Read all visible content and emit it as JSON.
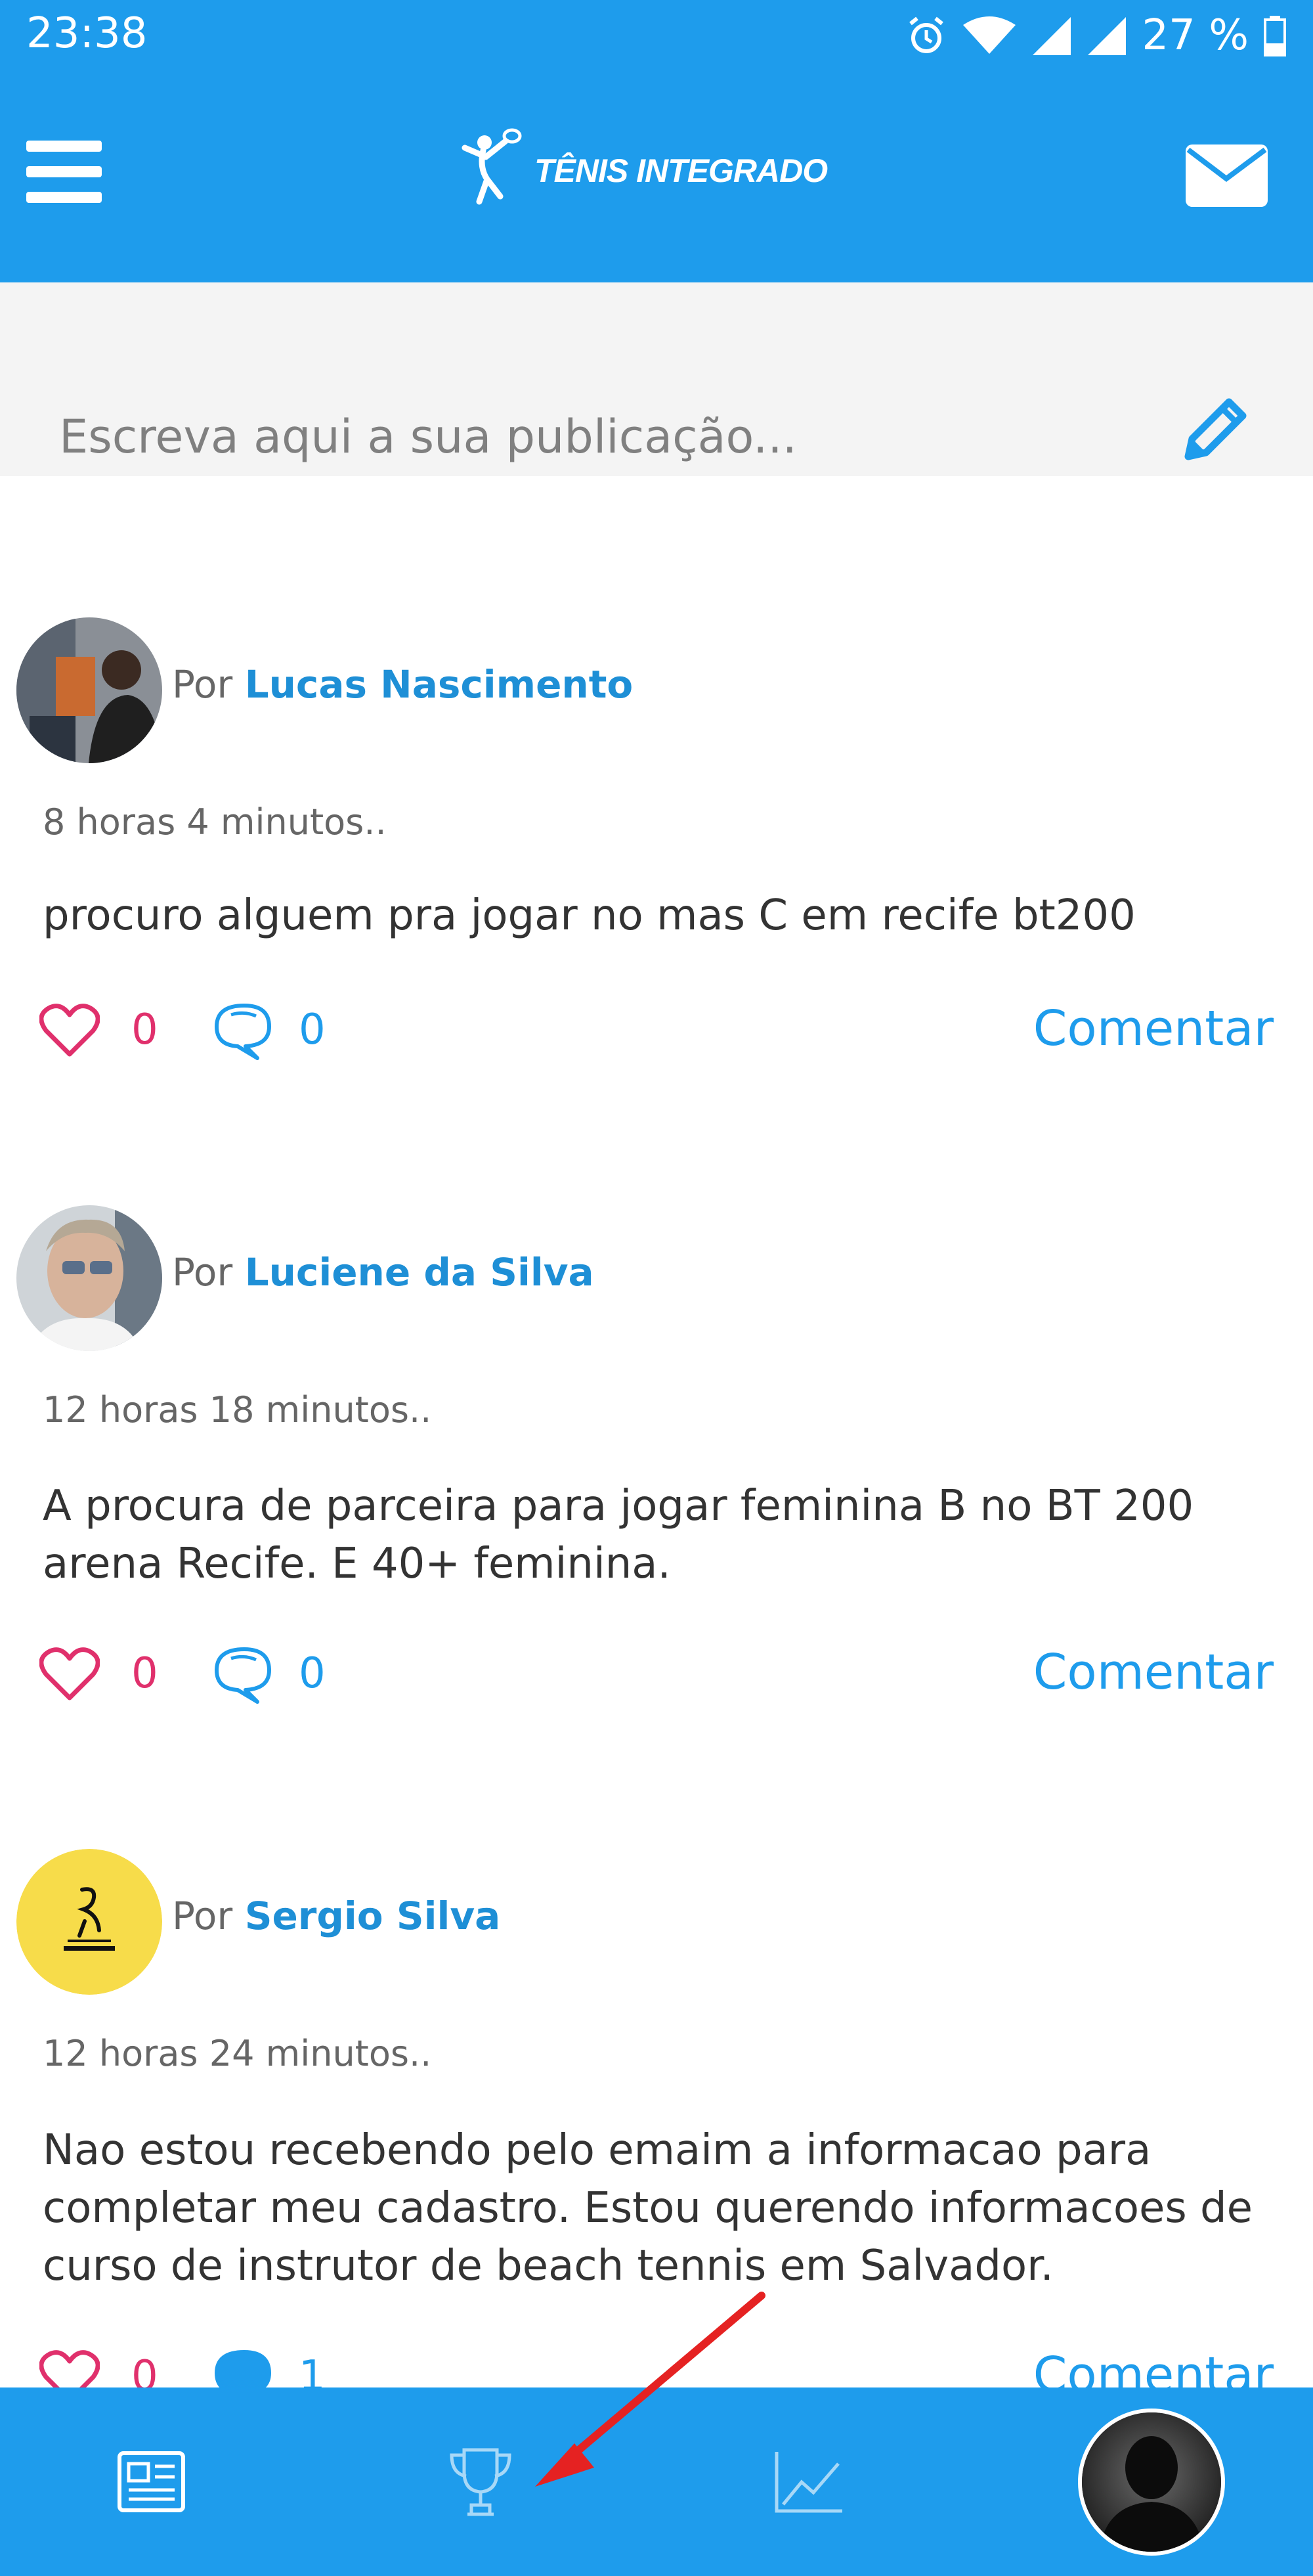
{
  "status_bar": {
    "time": "23:38",
    "battery": "27 %"
  },
  "header": {
    "app_name": "TÊNIS INTEGRADO"
  },
  "compose": {
    "placeholder": "Escreva aqui a sua publicação..."
  },
  "posts": [
    {
      "by_prefix": "Por",
      "author": "Lucas Nascimento",
      "time": "8 horas 4 minutos..",
      "text": "procuro alguem pra jogar no mas C em recife bt200",
      "likes": "0",
      "comments": "0",
      "comment_label": "Comentar"
    },
    {
      "by_prefix": "Por",
      "author": "Luciene da Silva",
      "time": "12 horas 18 minutos..",
      "text": "A procura de parceira para jogar feminina B no BT 200 arena Recife. E 40+ feminina.",
      "likes": "0",
      "comments": "0",
      "comment_label": "Comentar"
    },
    {
      "by_prefix": "Por",
      "author": "Sergio Silva",
      "time": "12 horas 24 minutos..",
      "text": "Nao estou recebendo pelo emaim a informacao para completar meu cadastro. Estou querendo informacoes de curso de instrutor de beach tennis em Salvador.",
      "likes": "0",
      "comments": "1",
      "comment_label": "Comentar"
    }
  ],
  "bottom_nav": {
    "items": [
      {
        "icon": "newspaper-icon"
      },
      {
        "icon": "trophy-icon"
      },
      {
        "icon": "chart-icon"
      },
      {
        "icon": "profile-avatar"
      }
    ]
  },
  "colors": {
    "primary": "#1e9cec",
    "like": "#e0306c",
    "text": "#333333",
    "annotation_arrow": "#e52222"
  }
}
